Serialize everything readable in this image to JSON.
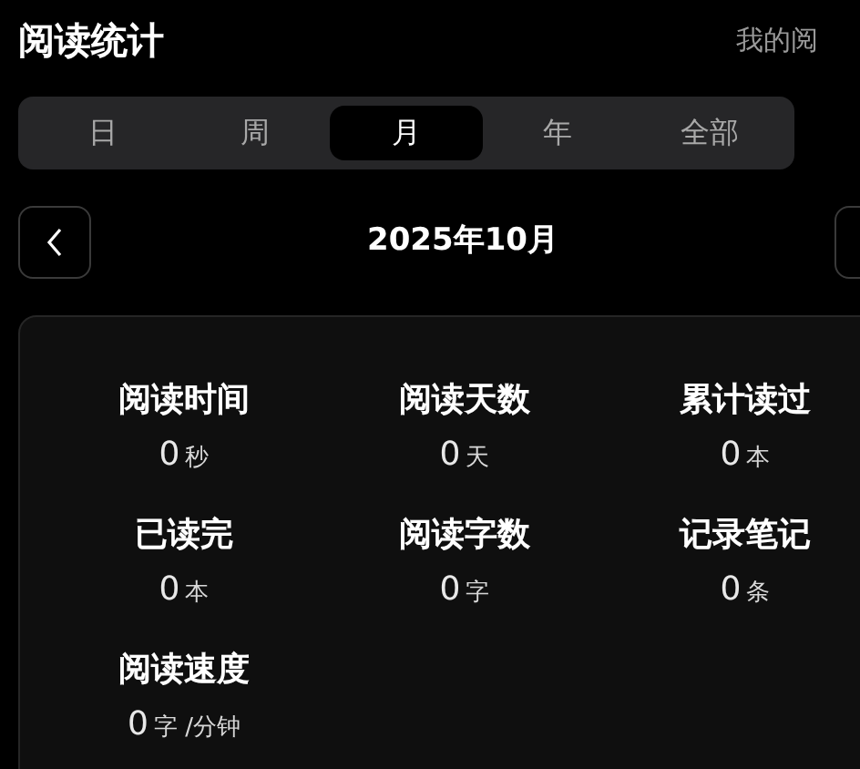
{
  "header": {
    "title": "阅读统计",
    "link": "我的阅"
  },
  "tabs": [
    {
      "label": "日",
      "selected": false
    },
    {
      "label": "周",
      "selected": false
    },
    {
      "label": "月",
      "selected": true
    },
    {
      "label": "年",
      "selected": false
    },
    {
      "label": "全部",
      "selected": false
    }
  ],
  "period": {
    "label": "2025年10月"
  },
  "stats": [
    {
      "label": "阅读时间",
      "value": "0",
      "unit": "秒"
    },
    {
      "label": "阅读天数",
      "value": "0",
      "unit": "天"
    },
    {
      "label": "累计读过",
      "value": "0",
      "unit": "本"
    },
    {
      "label": "已读完",
      "value": "0",
      "unit": "本"
    },
    {
      "label": "阅读字数",
      "value": "0",
      "unit": "字"
    },
    {
      "label": "记录笔记",
      "value": "0",
      "unit": "条"
    },
    {
      "label": "阅读速度",
      "value": "0",
      "unit": "字 /分钟"
    }
  ]
}
